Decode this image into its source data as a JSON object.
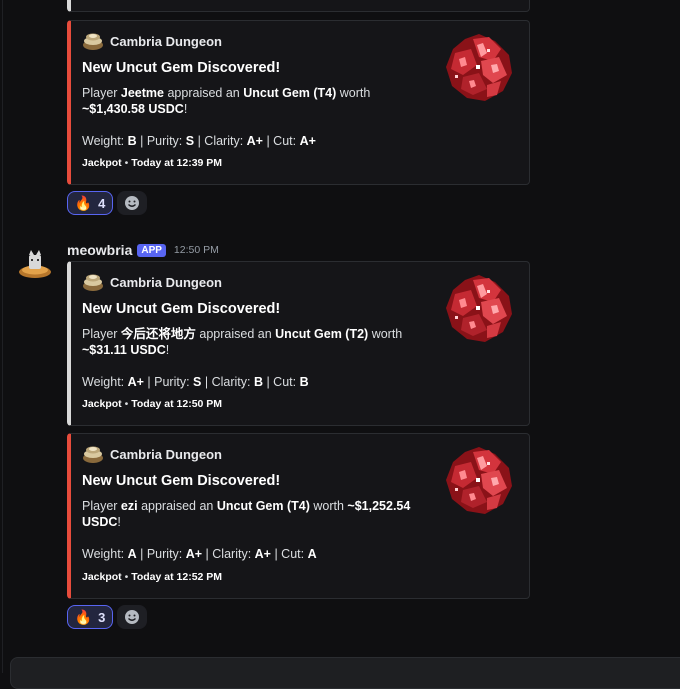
{
  "message": {
    "username": "meowbria",
    "badge": "APP",
    "time": "12:50 PM"
  },
  "embeds": [
    {
      "author": "Cambria Dungeon",
      "title": "New Uncut Gem Discovered!",
      "player_prefix": "Player ",
      "player": "Jeetme",
      "appraised": " appraised an ",
      "gem": "Uncut Gem (T4)",
      "worth": " worth ",
      "value": "~$1,430.58 USDC",
      "bang": "!",
      "weight_label": "Weight: ",
      "weight": "B",
      "purity_label": " | Purity: ",
      "purity": "S",
      "clarity_label": " | Clarity: ",
      "clarity": "A+",
      "cut_label": " | Cut: ",
      "cut": "A+",
      "footer_label": "Jackpot",
      "footer_sep": " • ",
      "footer_time": "Today at 12:39 PM"
    },
    {
      "author": "Cambria Dungeon",
      "title": "New Uncut Gem Discovered!",
      "player_prefix": "Player ",
      "player": "今后还将地方",
      "appraised": " appraised an ",
      "gem": "Uncut Gem (T2)",
      "worth": " worth ",
      "value": "~$31.11 USDC",
      "bang": "!",
      "weight_label": "Weight: ",
      "weight": "A+",
      "purity_label": " | Purity: ",
      "purity": "S",
      "clarity_label": " | Clarity: ",
      "clarity": "B",
      "cut_label": " | Cut: ",
      "cut": "B",
      "footer_label": "Jackpot",
      "footer_sep": " • ",
      "footer_time": "Today at 12:50 PM"
    },
    {
      "author": "Cambria Dungeon",
      "title": "New Uncut Gem Discovered!",
      "player_prefix": "Player ",
      "player": "ezi",
      "appraised": " appraised an ",
      "gem": "Uncut Gem (T4)",
      "worth": " worth ",
      "value": "~$1,252.54 USDC",
      "bang": "!",
      "weight_label": "Weight: ",
      "weight": "A",
      "purity_label": " | Purity: ",
      "purity": "A+",
      "clarity_label": " | Clarity: ",
      "clarity": "A+",
      "cut_label": " | Cut: ",
      "cut": "A",
      "footer_label": "Jackpot",
      "footer_sep": " • ",
      "footer_time": "Today at 12:52 PM"
    }
  ],
  "reactions": [
    {
      "emoji_icon": "fire-icon",
      "count": "4"
    },
    {
      "emoji_icon": "fire-icon",
      "count": "3"
    }
  ],
  "colors": {
    "embed_accent": "#e74c3c",
    "embed_accent_alt": "#d9d9d9",
    "app_badge": "#5865f2",
    "reaction_active_border": "#5865f2"
  }
}
